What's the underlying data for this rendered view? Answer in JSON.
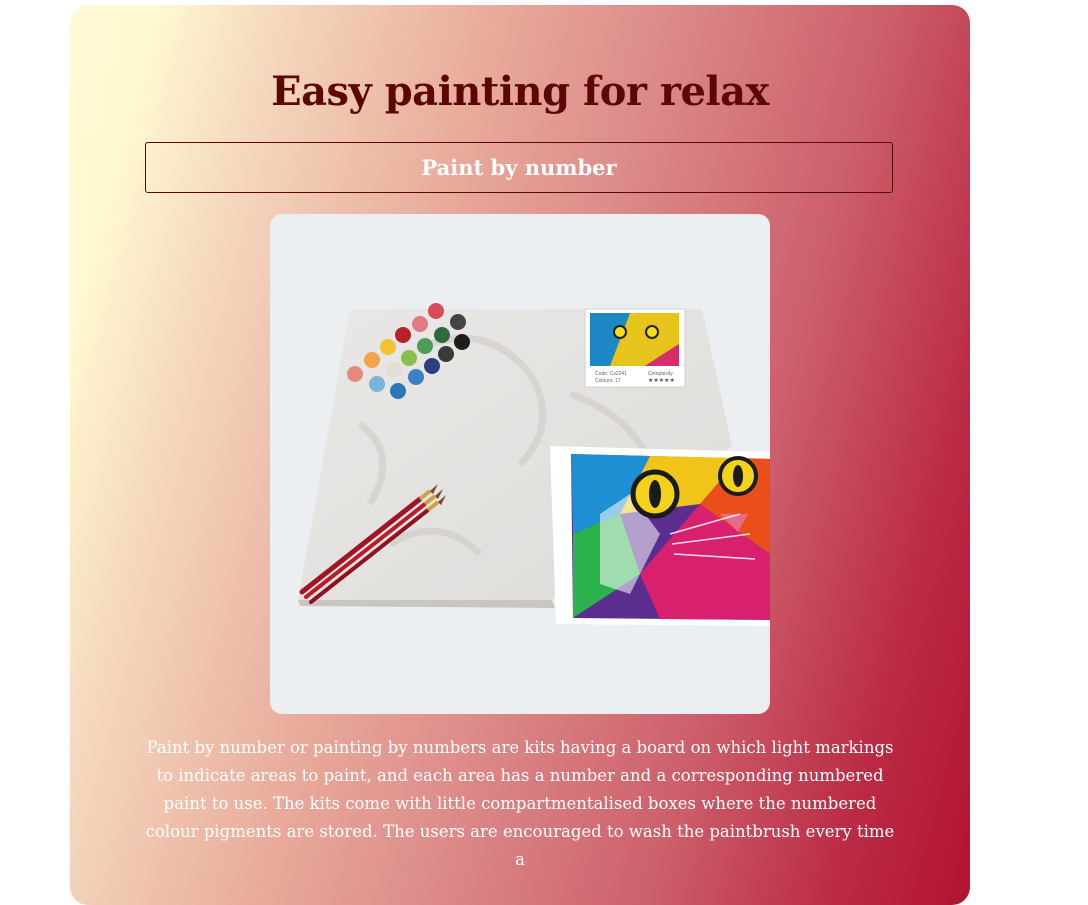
{
  "page": {
    "title": "Easy painting for relax",
    "subtitle": "Paint by number",
    "description": "Paint by number or painting by numbers are kits having a board on which light markings to indicate areas to paint, and each area has a number and a corresponding numbered paint to use. The kits come with little compartmentalised boxes where the numbered colour pigments are stored. The users are encouraged to wash the paintbrush every time a"
  },
  "hero_image": {
    "subject": "paint-by-number kit with canvas, paint pots, brushes and colourful cat print",
    "reference_card": {
      "code_label": "Code: Cs2241",
      "colours_label": "Colours: 17",
      "complexity_label": "Complexity"
    }
  },
  "colors": {
    "title": "#5c0707",
    "gradient_start": "#fffbd6",
    "gradient_end": "#b21330",
    "text_light": "#ffffff"
  }
}
